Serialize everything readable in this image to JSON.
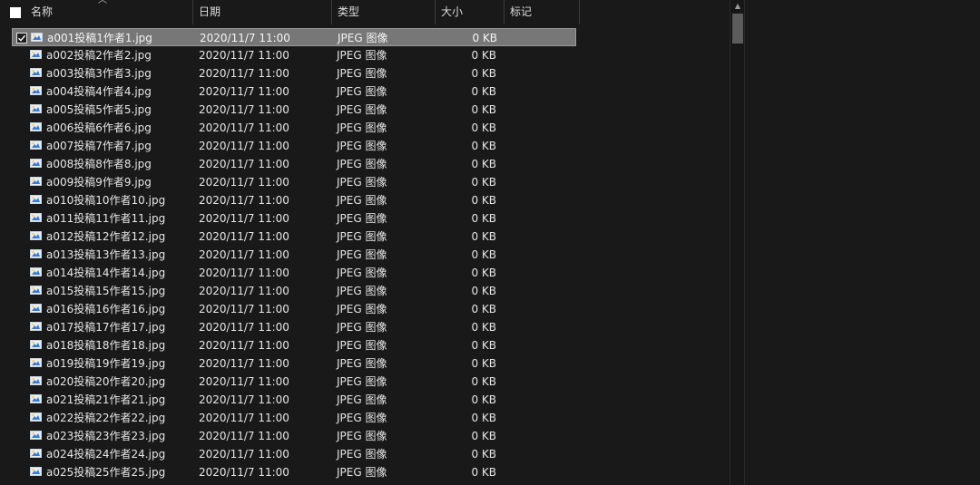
{
  "columns": {
    "name": "名称",
    "date": "日期",
    "type": "类型",
    "size": "大小",
    "tags": "标记"
  },
  "sort": {
    "column": "name",
    "direction": "ascending"
  },
  "files": [
    {
      "name": "a001投稿1作者1.jpg",
      "date": "2020/11/7 11:00",
      "type": "JPEG 图像",
      "size": "0 KB",
      "selected": true
    },
    {
      "name": "a002投稿2作者2.jpg",
      "date": "2020/11/7 11:00",
      "type": "JPEG 图像",
      "size": "0 KB"
    },
    {
      "name": "a003投稿3作者3.jpg",
      "date": "2020/11/7 11:00",
      "type": "JPEG 图像",
      "size": "0 KB"
    },
    {
      "name": "a004投稿4作者4.jpg",
      "date": "2020/11/7 11:00",
      "type": "JPEG 图像",
      "size": "0 KB"
    },
    {
      "name": "a005投稿5作者5.jpg",
      "date": "2020/11/7 11:00",
      "type": "JPEG 图像",
      "size": "0 KB"
    },
    {
      "name": "a006投稿6作者6.jpg",
      "date": "2020/11/7 11:00",
      "type": "JPEG 图像",
      "size": "0 KB"
    },
    {
      "name": "a007投稿7作者7.jpg",
      "date": "2020/11/7 11:00",
      "type": "JPEG 图像",
      "size": "0 KB"
    },
    {
      "name": "a008投稿8作者8.jpg",
      "date": "2020/11/7 11:00",
      "type": "JPEG 图像",
      "size": "0 KB"
    },
    {
      "name": "a009投稿9作者9.jpg",
      "date": "2020/11/7 11:00",
      "type": "JPEG 图像",
      "size": "0 KB"
    },
    {
      "name": "a010投稿10作者10.jpg",
      "date": "2020/11/7 11:00",
      "type": "JPEG 图像",
      "size": "0 KB"
    },
    {
      "name": "a011投稿11作者11.jpg",
      "date": "2020/11/7 11:00",
      "type": "JPEG 图像",
      "size": "0 KB"
    },
    {
      "name": "a012投稿12作者12.jpg",
      "date": "2020/11/7 11:00",
      "type": "JPEG 图像",
      "size": "0 KB"
    },
    {
      "name": "a013投稿13作者13.jpg",
      "date": "2020/11/7 11:00",
      "type": "JPEG 图像",
      "size": "0 KB"
    },
    {
      "name": "a014投稿14作者14.jpg",
      "date": "2020/11/7 11:00",
      "type": "JPEG 图像",
      "size": "0 KB"
    },
    {
      "name": "a015投稿15作者15.jpg",
      "date": "2020/11/7 11:00",
      "type": "JPEG 图像",
      "size": "0 KB"
    },
    {
      "name": "a016投稿16作者16.jpg",
      "date": "2020/11/7 11:00",
      "type": "JPEG 图像",
      "size": "0 KB"
    },
    {
      "name": "a017投稿17作者17.jpg",
      "date": "2020/11/7 11:00",
      "type": "JPEG 图像",
      "size": "0 KB"
    },
    {
      "name": "a018投稿18作者18.jpg",
      "date": "2020/11/7 11:00",
      "type": "JPEG 图像",
      "size": "0 KB"
    },
    {
      "name": "a019投稿19作者19.jpg",
      "date": "2020/11/7 11:00",
      "type": "JPEG 图像",
      "size": "0 KB"
    },
    {
      "name": "a020投稿20作者20.jpg",
      "date": "2020/11/7 11:00",
      "type": "JPEG 图像",
      "size": "0 KB"
    },
    {
      "name": "a021投稿21作者21.jpg",
      "date": "2020/11/7 11:00",
      "type": "JPEG 图像",
      "size": "0 KB"
    },
    {
      "name": "a022投稿22作者22.jpg",
      "date": "2020/11/7 11:00",
      "type": "JPEG 图像",
      "size": "0 KB"
    },
    {
      "name": "a023投稿23作者23.jpg",
      "date": "2020/11/7 11:00",
      "type": "JPEG 图像",
      "size": "0 KB"
    },
    {
      "name": "a024投稿24作者24.jpg",
      "date": "2020/11/7 11:00",
      "type": "JPEG 图像",
      "size": "0 KB"
    },
    {
      "name": "a025投稿25作者25.jpg",
      "date": "2020/11/7 11:00",
      "type": "JPEG 图像",
      "size": "0 KB"
    }
  ],
  "colors": {
    "background": "#191919",
    "text": "#e6e6e6",
    "selected_row": "#777777",
    "scroll_thumb": "#5c5c5c"
  },
  "icons": {
    "file": "jpeg-image-icon",
    "sort": "sort-ascending-icon",
    "checkbox": "checkbox-icon"
  }
}
